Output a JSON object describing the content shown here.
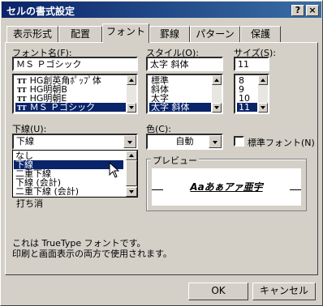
{
  "window": {
    "title": "セルの書式設定",
    "help": "?",
    "close": "×"
  },
  "tabs": [
    {
      "label": "表示形式"
    },
    {
      "label": "配置"
    },
    {
      "label": "フォント"
    },
    {
      "label": "罫線"
    },
    {
      "label": "パターン"
    },
    {
      "label": "保護"
    }
  ],
  "font": {
    "label": "フォント名(F):",
    "value": "ＭＳ Ｐゴシック",
    "items": [
      "HG創英角ﾎﾟｯﾌﾟ体",
      "HG明朝B",
      "HG明朝E",
      "ＭＳ Ｐゴシック"
    ],
    "icon": "TT"
  },
  "style": {
    "label": "スタイル(O):",
    "value": "太字 斜体",
    "items": [
      "標準",
      "斜体",
      "太字",
      "太字 斜体"
    ]
  },
  "size": {
    "label": "サイズ(S):",
    "value": "11",
    "items": [
      "8",
      "9",
      "10",
      "11"
    ]
  },
  "underline": {
    "label": "下線(U):",
    "value": "下線",
    "options": [
      "なし",
      "下線",
      "二重下線",
      "下線 (会計)",
      "二重下線 (会計)"
    ]
  },
  "hidden_partial": "打ち消",
  "color": {
    "label": "色(C):",
    "value": "自動"
  },
  "normal_font": {
    "label": "標準フォント(N)"
  },
  "preview": {
    "label": "プレビュー",
    "sample": "Aaあぁアァ亜宇"
  },
  "description": {
    "line1": "これは TrueType フォントです。",
    "line2": "印刷と画面表示の両方で使用されます。"
  },
  "buttons": {
    "ok": "OK",
    "cancel": "キャンセル"
  }
}
